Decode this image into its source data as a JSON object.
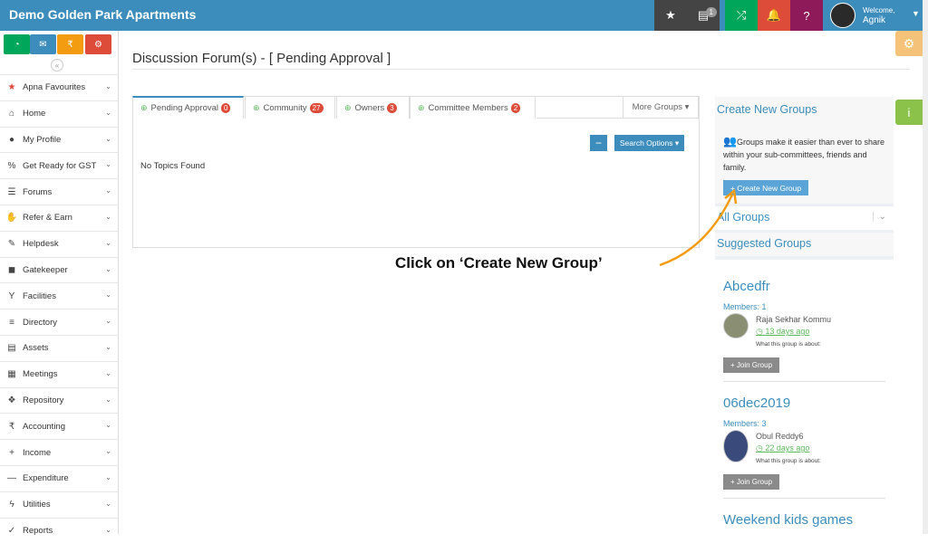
{
  "app": {
    "title": "Demo Golden Park Apartments"
  },
  "topbar": {
    "notif_count": "1",
    "welcome": "Welcome,",
    "user": "Agnik"
  },
  "colors": {
    "brand": "#3c8dbc",
    "danger": "#dd4b39",
    "success": "#00a65a"
  },
  "quick_icons": [
    {
      "name": "dashboard-icon",
      "color": "#dd4b39",
      "glyph": "◔"
    },
    {
      "name": "chat-icon",
      "color": "#3c8dbc",
      "glyph": "💬"
    },
    {
      "name": "rupee-icon",
      "color": "#f39c12",
      "glyph": "₹"
    },
    {
      "name": "settings-icon",
      "color": "#dd4b39",
      "glyph": "⚙"
    }
  ],
  "sidebar": {
    "items": [
      {
        "label": "Apna Favourites",
        "icon": "★"
      },
      {
        "label": "Home",
        "icon": "⌂"
      },
      {
        "label": "My Profile",
        "icon": "●"
      },
      {
        "label": "Get Ready for GST",
        "icon": "%"
      },
      {
        "label": "Forums",
        "icon": "☰"
      },
      {
        "label": "Refer & Earn",
        "icon": "✋"
      },
      {
        "label": "Helpdesk",
        "icon": "✎"
      },
      {
        "label": "Gatekeeper",
        "icon": "◼"
      },
      {
        "label": "Facilities",
        "icon": "Y"
      },
      {
        "label": "Directory",
        "icon": "≡"
      },
      {
        "label": "Assets",
        "icon": "▤"
      },
      {
        "label": "Meetings",
        "icon": "▦"
      },
      {
        "label": "Repository",
        "icon": "❖"
      },
      {
        "label": "Accounting",
        "icon": "₹"
      },
      {
        "label": "Income",
        "icon": "+"
      },
      {
        "label": "Expenditure",
        "icon": "—"
      },
      {
        "label": "Utilities",
        "icon": "ϟ"
      },
      {
        "label": "Reports",
        "icon": "✓"
      }
    ]
  },
  "main": {
    "title": "Discussion Forum(s) - [ Pending Approval ]",
    "tabs": [
      {
        "label": "Pending Approval",
        "count": "0"
      },
      {
        "label": "Community",
        "count": "27"
      },
      {
        "label": "Owners",
        "count": "3"
      },
      {
        "label": "Committee Members",
        "count": "2"
      }
    ],
    "more_groups": "More Groups",
    "search_options": "Search Options",
    "empty": "No Topics Found"
  },
  "right": {
    "create_title": "Create New Groups",
    "create_desc": "Groups make it easier than ever to share within your sub-committees, friends and family.",
    "create_button": "+ Create New Group",
    "all_groups": "All Groups",
    "suggested": "Suggested Groups",
    "groups": [
      {
        "name": "Abcedfr",
        "members": "Members: 1",
        "member_name": "Raja Sekhar Kommu",
        "days": "13 days ago",
        "about": "What this group is about:",
        "join": "+ Join Group"
      },
      {
        "name": "06dec2019",
        "members": "Members: 3",
        "member_name": "Obul Reddy6",
        "days": "22 days ago",
        "about": "What this group is about:",
        "join": "+ Join Group"
      },
      {
        "name": "Weekend kids games"
      }
    ]
  },
  "callout": "Click on ‘Create New Group’"
}
